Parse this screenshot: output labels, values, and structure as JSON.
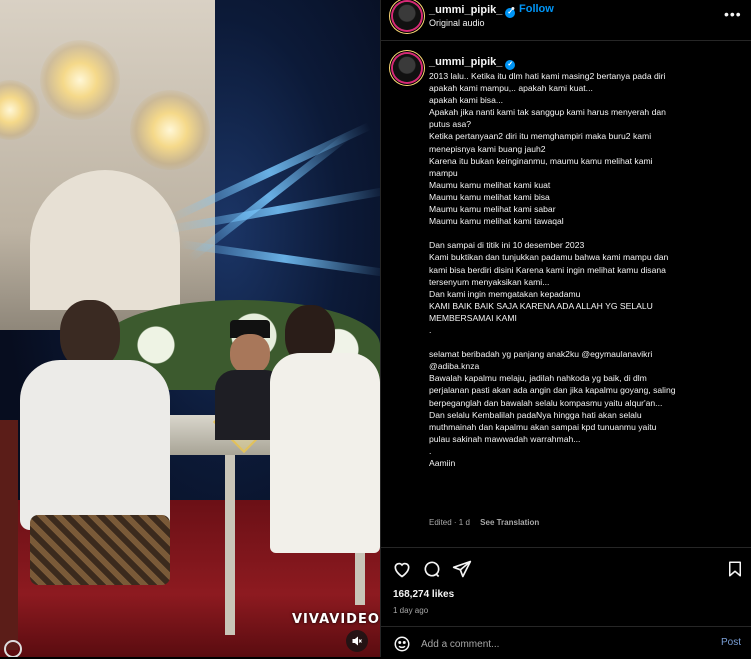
{
  "video": {
    "watermark": "VIVAVIDEO",
    "mute_icon": "speaker-muted-icon"
  },
  "header": {
    "username": "_ummi_pipik_",
    "separator": "•",
    "follow_label": "Follow",
    "audio_label": "Original audio",
    "more_icon": "more-horizontal-icon"
  },
  "caption": {
    "username": "_ummi_pipik_",
    "trailing": ".",
    "lines": [
      "2013 lalu.. Ketika itu dlm hati kami masing2 bertanya pada diri",
      "apakah kami mampu,.. apakah kami kuat...",
      "apakah kami bisa...",
      "Apakah jika nanti kami tak sanggup kami harus menyerah dan",
      "putus asa?",
      "Ketika pertanyaan2 diri itu memghampiri maka buru2 kami",
      "menepisnya kami buang jauh2",
      "Karena itu bukan keinginanmu, maumu kamu melihat kami",
      "mampu",
      "Maumu kamu melihat kami kuat",
      "Maumu kamu melihat kami bisa",
      "Maumu kamu melihat kami sabar",
      "Maumu kamu melihat kami tawaqal",
      "",
      "Dan sampai di titik ini 10 desember 2023",
      "Kami buktikan dan tunjukkan padamu bahwa kami mampu dan",
      "kami bisa berdiri disini Karena kami ingin melihat kamu disana",
      "tersenyum menyaksikan kami...",
      "Dan kami ingin memgatakan kepadamu",
      "KAMI BAIK BAIK SAJA KARENA ADA ALLAH YG SELALU",
      "MEMBERSAMAI KAMI",
      ".",
      "",
      "selamat beribadah yg panjang anak2ku @egymaulanavikri",
      "@adiba.knza",
      "Bawalah kapalmu melaju, jadilah nahkoda yg baik, di dlm",
      "perjalanan pasti akan ada angin dan jika kapalmu goyang, saling",
      "berpeganglah dan bawalah selalu kompasmu yaitu alqur'an...",
      "Dan selalu Kembalilah padaNya hingga hati akan selalu",
      "muthmainah dan kapalmu akan sampai kpd tunuanmu yaitu",
      "pulau sakinah mawwadah warrahmah...",
      ".",
      "Aamiin"
    ],
    "edited": "Edited · 1 d",
    "see_translation": "See Translation"
  },
  "actions": {
    "like_icon": "heart-icon",
    "comment_icon": "comment-icon",
    "share_icon": "share-icon",
    "save_icon": "bookmark-icon",
    "likes": "168,274 likes",
    "time_ago": "1 day ago"
  },
  "comment": {
    "emoji_icon": "emoji-icon",
    "placeholder": "Add a comment...",
    "post_label": "Post"
  },
  "colors": {
    "accent": "#0095f6",
    "background": "#000000",
    "muted_text": "#a8a8a8"
  }
}
